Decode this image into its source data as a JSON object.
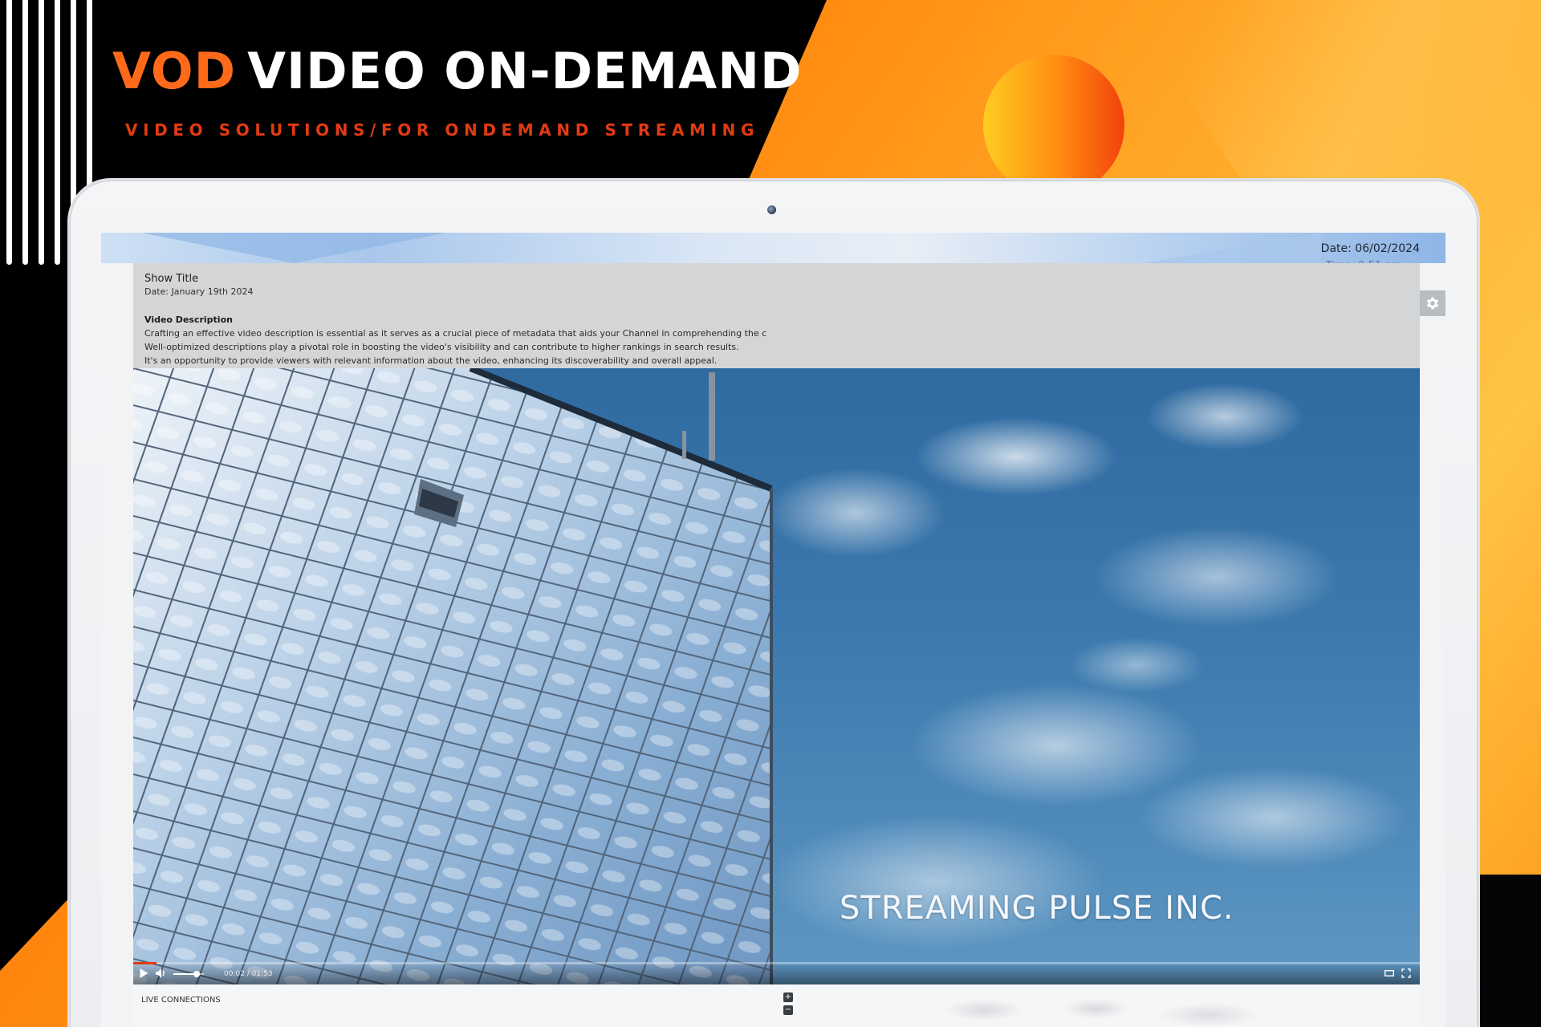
{
  "promo": {
    "title_accent": "VOD",
    "title_rest": "VIDEO ON-DEMAND",
    "subtitle": "VIDEO SOLUTIONS/FOR ONDEMAND STREAMING",
    "colors": {
      "accent": "#ff6a1a",
      "subtitle": "#e23a12",
      "background_dark": "#000000",
      "background_orange": "#ff8a10"
    }
  },
  "screen": {
    "date": "Date: 06/02/2024"
  },
  "info_panel": {
    "show_title": "Show Title",
    "show_date": "Date: January 19th 2024",
    "description_heading": "Video Description",
    "description_lines": [
      "Crafting an effective video description is essential as it serves as a crucial piece of metadata that aids your Channel in comprehending the c",
      "Well-optimized descriptions play a pivotal role in boosting the video's visibility and can contribute to higher rankings in search results.",
      "It's an opportunity to provide viewers with relevant information about the video, enhancing its discoverability and overall appeal."
    ]
  },
  "video": {
    "watermark": "STREAMING PULSE  INC.",
    "time_display": "00:02 / 01:53",
    "progress": 0.018,
    "volume": 0.75,
    "icons": {
      "play": "play-icon",
      "volume": "volume-icon",
      "theater": "theater-mode-icon",
      "fullscreen": "fullscreen-icon",
      "settings": "gear-icon"
    }
  },
  "live": {
    "label": "LIVE CONNECTIONS",
    "zoom_in": "+",
    "zoom_out": "−"
  }
}
